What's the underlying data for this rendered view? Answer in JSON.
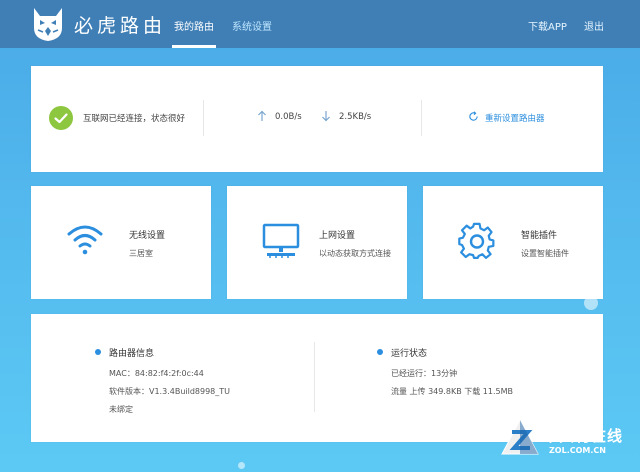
{
  "header": {
    "brand": "必虎路由",
    "nav": [
      {
        "label": "我的路由"
      },
      {
        "label": "系统设置"
      }
    ],
    "download_app": "下载APP",
    "logout": "退出"
  },
  "status": {
    "text": "互联网已经连接，状态很好",
    "upload_speed": "0.0B/s",
    "download_speed": "2.5KB/s",
    "reset_label": "重新设置路由器",
    "icons": [
      "check-icon",
      "upload-arrow-icon",
      "download-arrow-icon",
      "refresh-icon"
    ]
  },
  "tiles": [
    {
      "title": "无线设置",
      "subtitle": "三居室",
      "icon": "wifi-icon"
    },
    {
      "title": "上网设置",
      "subtitle": "以动态获取方式连接",
      "icon": "monitor-icon"
    },
    {
      "title": "智能插件",
      "subtitle": "设置智能插件",
      "icon": "gear-icon"
    }
  ],
  "router_info": {
    "title": "路由器信息",
    "mac": "MAC：84:82:f4:2f:0c:44",
    "firmware": "软件版本：V1.3.4Build8998_TU",
    "binding": "未绑定"
  },
  "run_status": {
    "title": "运行状态",
    "uptime": "已经运行：13分钟",
    "traffic": "流量 上传 349.8KB 下载 11.5MB"
  },
  "watermark": {
    "cn": "中关村在线",
    "en": "ZOL.COM.CN"
  },
  "colors": {
    "accent": "#2b8ede",
    "topbar": "#3f7fb6",
    "ok": "#8dc63f"
  }
}
